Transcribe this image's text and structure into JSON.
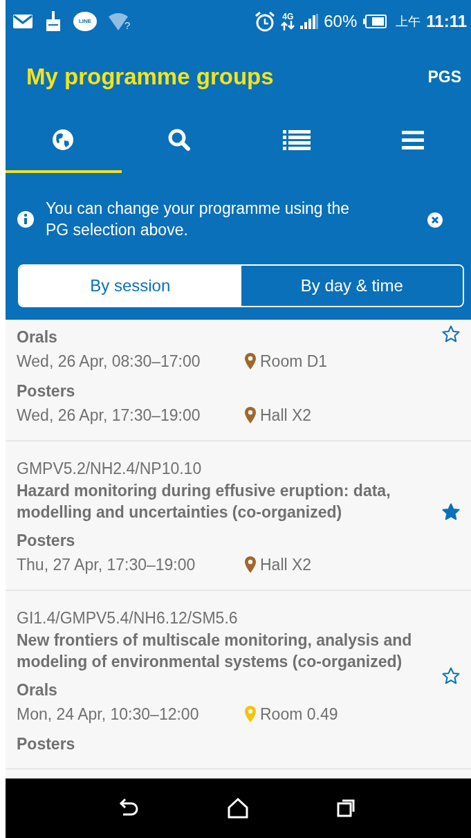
{
  "status_bar": {
    "line_badge": "LINE",
    "wifi_mark": "?",
    "network": "4G",
    "battery": "60%",
    "am_pm": "上午",
    "time": "11:11"
  },
  "header": {
    "title": "My programme groups",
    "action": "PGS"
  },
  "tabs": [
    {
      "selected": true
    },
    {
      "selected": false
    },
    {
      "selected": false
    },
    {
      "selected": false
    }
  ],
  "notice": {
    "text": "You can change your programme using the PG selection above."
  },
  "view_toggle": [
    {
      "label": "By session",
      "selected": true
    },
    {
      "label": "By day & time",
      "selected": false
    }
  ],
  "groups": [
    {
      "starred": false,
      "sessions": [
        {
          "type": "Orals",
          "time": "Wed, 26 Apr, 08:30–17:00",
          "location": "Room D1",
          "color": "#a0672a"
        },
        {
          "type": "Posters",
          "time": "Wed, 26 Apr, 17:30–19:00",
          "location": "Hall X2",
          "color": "#a0672a"
        }
      ]
    },
    {
      "code": "GMPV5.2/NH2.4/NP10.10",
      "title": "Hazard monitoring during effusive eruption: data, modelling and uncertainties (co-organized)",
      "starred": true,
      "sessions": [
        {
          "type": "Posters",
          "time": "Thu, 27 Apr, 17:30–19:00",
          "location": "Hall X2",
          "color": "#a0672a"
        }
      ]
    },
    {
      "code": "GI1.4/GMPV5.4/NH6.12/SM5.6",
      "title": "New frontiers of multiscale monitoring, analysis and modeling of environmental systems (co-organized)",
      "starred": false,
      "sessions": [
        {
          "type": "Orals",
          "time": "Mon, 24 Apr, 10:30–12:00",
          "location": "Room 0.49",
          "color": "#f5c400"
        },
        {
          "type": "Posters"
        }
      ]
    }
  ]
}
